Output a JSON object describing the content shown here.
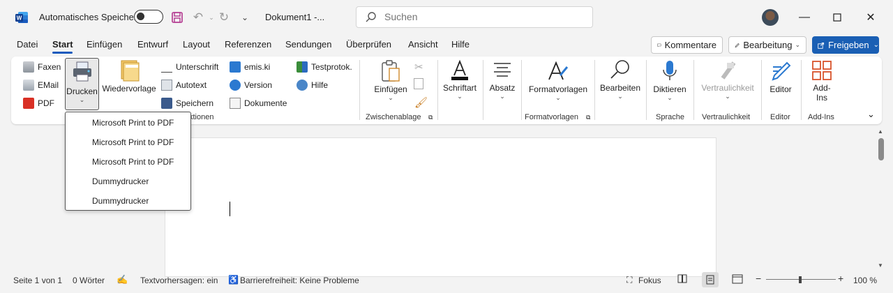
{
  "titlebar": {
    "autosave_label": "Automatisches Speichern",
    "doc_title": "Dokument1  -...",
    "search_placeholder": "Suchen"
  },
  "tabs": [
    "Datei",
    "Start",
    "Einfügen",
    "Entwurf",
    "Layout",
    "Referenzen",
    "Sendungen",
    "Überprüfen",
    "Ansicht",
    "Hilfe"
  ],
  "top_buttons": {
    "comments": "Kommentare",
    "editing": "Bearbeitung",
    "share": "Freigeben"
  },
  "ribbon": {
    "faxen": "Faxen",
    "email": "EMail",
    "pdf": "PDF",
    "drucken": "Drucken",
    "wiedervorlage": "Wiedervorlage",
    "unterschrift": "Unterschrift",
    "autotext": "Autotext",
    "speichern": "Speichern",
    "emiski": "emis.ki",
    "version": "Version",
    "dokumente": "Dokumente",
    "testprotok": "Testprotok.",
    "hilfe": "Hilfe",
    "funktionen_partial": "ktionen",
    "einfuegen": "Einfügen",
    "zwischenablage": "Zwischenablage",
    "schriftart": "Schriftart",
    "absatz": "Absatz",
    "formatvorlagen": "Formatvorlagen",
    "bearbeiten": "Bearbeiten",
    "diktieren": "Diktieren",
    "sprache": "Sprache",
    "vertraulichkeit": "Vertraulichkeit",
    "editor": "Editor",
    "addins_line1": "Add-",
    "addins_line2": "Ins",
    "addins_group": "Add-Ins"
  },
  "printer_menu": [
    "Microsoft Print to PDF",
    "Microsoft Print to PDF",
    "Microsoft Print to PDF",
    "Dummydrucker",
    "Dummydrucker"
  ],
  "statusbar": {
    "page": "Seite 1 von 1",
    "words": "0 Wörter",
    "prediction": "Textvorhersagen: ein",
    "accessibility": "Barrierefreiheit: Keine Probleme",
    "focus": "Fokus",
    "zoom": "100 %"
  },
  "colors": {
    "accent": "#185abd",
    "share": "#1a5fb4"
  }
}
